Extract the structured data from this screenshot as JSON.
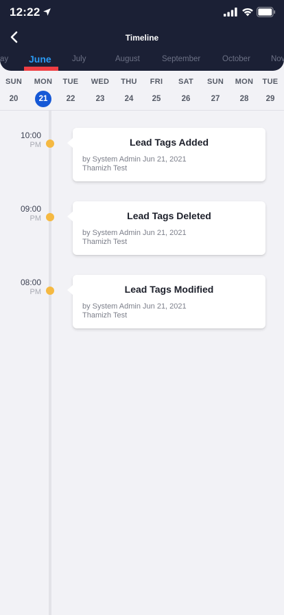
{
  "status_bar": {
    "time": "12:22",
    "icons": [
      "location-arrow-icon",
      "cellular-signal-icon",
      "wifi-icon",
      "battery-icon"
    ]
  },
  "header": {
    "title": "Timeline",
    "back_icon": "chevron-left-icon"
  },
  "months": [
    {
      "label": "ay",
      "active": false
    },
    {
      "label": "June",
      "active": true
    },
    {
      "label": "July",
      "active": false
    },
    {
      "label": "August",
      "active": false
    },
    {
      "label": "September",
      "active": false
    },
    {
      "label": "October",
      "active": false
    },
    {
      "label": "Nov",
      "active": false
    }
  ],
  "days": [
    {
      "name": "SUN",
      "date": "20",
      "selected": false
    },
    {
      "name": "MON",
      "date": "21",
      "selected": true
    },
    {
      "name": "TUE",
      "date": "22",
      "selected": false
    },
    {
      "name": "WED",
      "date": "23",
      "selected": false
    },
    {
      "name": "THU",
      "date": "24",
      "selected": false
    },
    {
      "name": "FRI",
      "date": "25",
      "selected": false
    },
    {
      "name": "SAT",
      "date": "26",
      "selected": false
    },
    {
      "name": "SUN",
      "date": "27",
      "selected": false
    },
    {
      "name": "MON",
      "date": "28",
      "selected": false
    },
    {
      "name": "TUE",
      "date": "29",
      "selected": false
    }
  ],
  "events": [
    {
      "time": "10:00",
      "ampm": "PM",
      "title": "Lead Tags Added",
      "meta": "by System Admin Jun  21, 2021",
      "user": "Thamizh Test"
    },
    {
      "time": "09:00",
      "ampm": "PM",
      "title": "Lead Tags Deleted",
      "meta": "by System Admin Jun 21, 2021",
      "user": "Thamizh Test"
    },
    {
      "time": "08:00",
      "ampm": "PM",
      "title": "Lead Tags Modified",
      "meta": "by System Admin Jun 21, 2021",
      "user": "Thamizh Test"
    }
  ],
  "colors": {
    "header_bg": "#1b2035",
    "active_month": "#2b9af3",
    "month_underline": "#ef3e43",
    "selected_day": "#1558d6",
    "timeline_dot": "#f5b942",
    "page_bg": "#f2f2f6"
  }
}
